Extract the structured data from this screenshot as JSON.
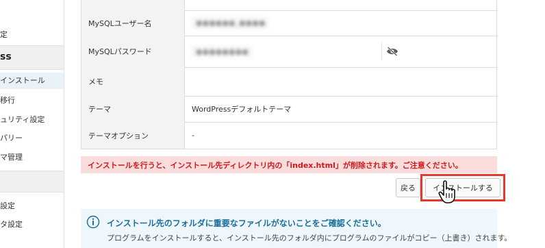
{
  "sidebar": {
    "items": [
      {
        "label": "定"
      },
      {
        "label": "ss"
      },
      {
        "label": "インストール"
      },
      {
        "label": "移行"
      },
      {
        "label": "ュリティ設定"
      },
      {
        "label": "パリー"
      },
      {
        "label": "マ管理"
      },
      {
        "label": "設定"
      },
      {
        "label": "タ設定"
      }
    ]
  },
  "form": {
    "rows": [
      {
        "label": "MySQLユーザー名",
        "value": "●●●●●●_●●●●"
      },
      {
        "label": "MySQLパスワード",
        "value": "●●●●●●●●"
      },
      {
        "label": "メモ",
        "value": ""
      },
      {
        "label": "テーマ",
        "value": "WordPressデフォルトテーマ"
      },
      {
        "label": "テーマオプション",
        "value": "-"
      }
    ]
  },
  "warning": "インストールを行うと、インストール先ディレクトリ内の「index.html」が削除されます。ご注意ください。",
  "buttons": {
    "back": "戻る",
    "install": "インストールする"
  },
  "info": {
    "title": "インストール先のフォルダに重要なファイルがないことをご確認ください。",
    "body": "プログラムをインストールすると、インストール先のフォルダ内にプログラムのファイルがコピー（上書き）されます。"
  },
  "colors": {
    "warning_bg": "#fbdcdc",
    "warning_text": "#cc1a1a",
    "highlight": "#e33a2b",
    "info_title": "#1c6e9c"
  }
}
